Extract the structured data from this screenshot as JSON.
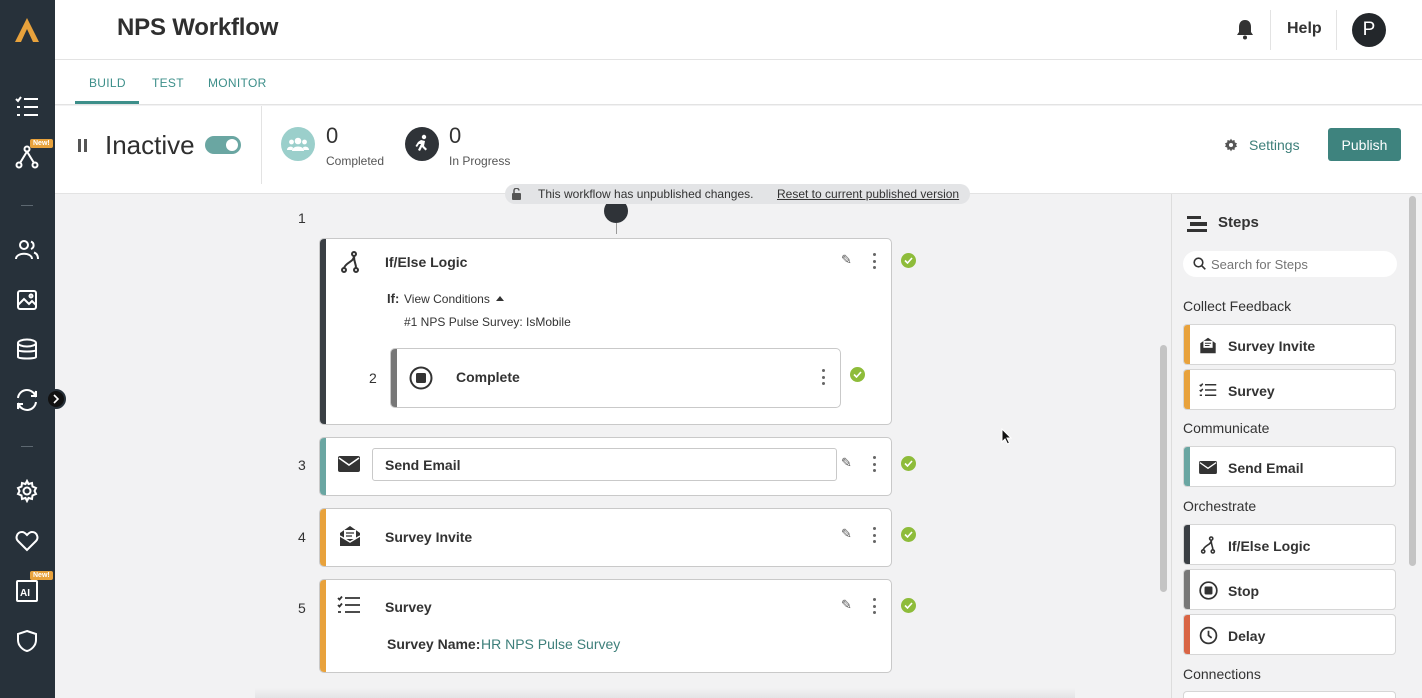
{
  "app": {
    "title": "NPS Workflow",
    "help": "Help",
    "avatar_initial": "P"
  },
  "nav": {
    "new_badge": "New!"
  },
  "tabs": [
    {
      "label": "BUILD"
    },
    {
      "label": "TEST"
    },
    {
      "label": "MONITOR"
    }
  ],
  "status": {
    "state": "Inactive",
    "completed_count": "0",
    "completed_label": "Completed",
    "inprogress_count": "0",
    "inprogress_label": "In Progress",
    "settings_label": "Settings",
    "publish_label": "Publish"
  },
  "banner": {
    "text": "This workflow has unpublished changes.",
    "link": "Reset to current published version"
  },
  "workflow": {
    "steps": [
      {
        "num": "1",
        "title": "If/Else Logic",
        "if_label": "If:",
        "view_conditions": "View Conditions",
        "condition": "#1 NPS Pulse Survey: IsMobile"
      },
      {
        "num": "2",
        "title": "Complete"
      },
      {
        "num": "3",
        "title": "Send Email"
      },
      {
        "num": "4",
        "title": "Survey Invite"
      },
      {
        "num": "5",
        "title": "Survey",
        "field_label": "Survey Name:",
        "field_value": "HR NPS Pulse Survey"
      }
    ]
  },
  "panel": {
    "title": "Steps",
    "search_placeholder": "Search for Steps",
    "categories": [
      {
        "name": "Collect Feedback",
        "items": [
          "Survey Invite",
          "Survey"
        ]
      },
      {
        "name": "Communicate",
        "items": [
          "Send Email"
        ]
      },
      {
        "name": "Orchestrate",
        "items": [
          "If/Else Logic",
          "Stop",
          "Delay"
        ]
      },
      {
        "name": "Connections",
        "items": []
      }
    ]
  },
  "colors": {
    "accent": "#3e837e",
    "orange": "#e8a23c",
    "teal": "#6aa6a2",
    "dark": "#3a3f44",
    "red": "#d96545",
    "check": "#8ebc3a"
  }
}
